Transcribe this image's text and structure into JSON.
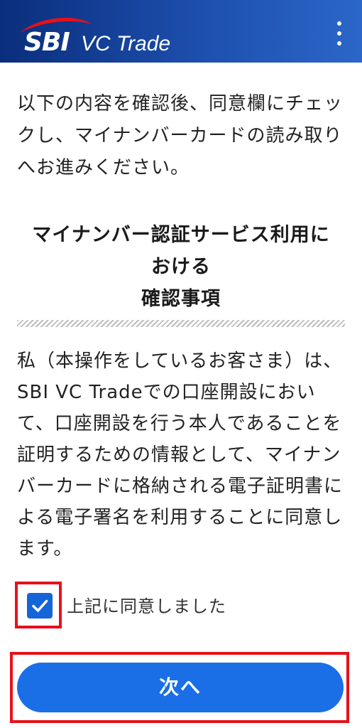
{
  "header": {
    "brand_primary": "SBI",
    "brand_secondary": "VC Trade",
    "menu_icon": "more-vertical-icon",
    "gradient_colors": [
      "#0a2e7c",
      "#2b67c8"
    ]
  },
  "instruction": {
    "text": "以下の内容を確認後、同意欄にチェックし、マイナンバーカードの読み取りへお進みください。"
  },
  "section": {
    "title_line1": "マイナンバー認証サービス利用に",
    "title_line2": "おける",
    "title_line3": "確認事項"
  },
  "agreement": {
    "text": "私（本操作をしているお客さま）は、SBI VC Tradeでの口座開設において、口座開設を行う本人であることを証明するための情報として、マイナンバーカードに格納される電子証明書による電子署名を利用することに同意します。"
  },
  "consent": {
    "label": "上記に同意しました",
    "checked": true,
    "icon": "checkmark-icon",
    "color": "#1565d8"
  },
  "actions": {
    "next_label": "次へ",
    "button_color": "#1a6fe6",
    "highlight_color": "#e8101a"
  }
}
